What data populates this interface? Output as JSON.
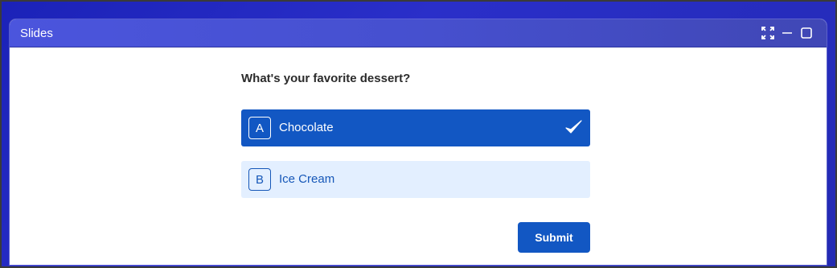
{
  "window": {
    "title": "Slides",
    "controls": [
      "fullscreen-icon",
      "minimize-icon",
      "maximize-icon"
    ]
  },
  "quiz": {
    "question": "What's your favorite dessert?",
    "options": [
      {
        "letter": "A",
        "label": "Chocolate",
        "selected": true
      },
      {
        "letter": "B",
        "label": "Ice Cream",
        "selected": false
      }
    ],
    "submit_label": "Submit"
  },
  "colors": {
    "accent": "#1257c3",
    "option_unselected_bg": "#e3efff",
    "titlebar": "#4650cf",
    "desktop": "#2a2fc9"
  }
}
